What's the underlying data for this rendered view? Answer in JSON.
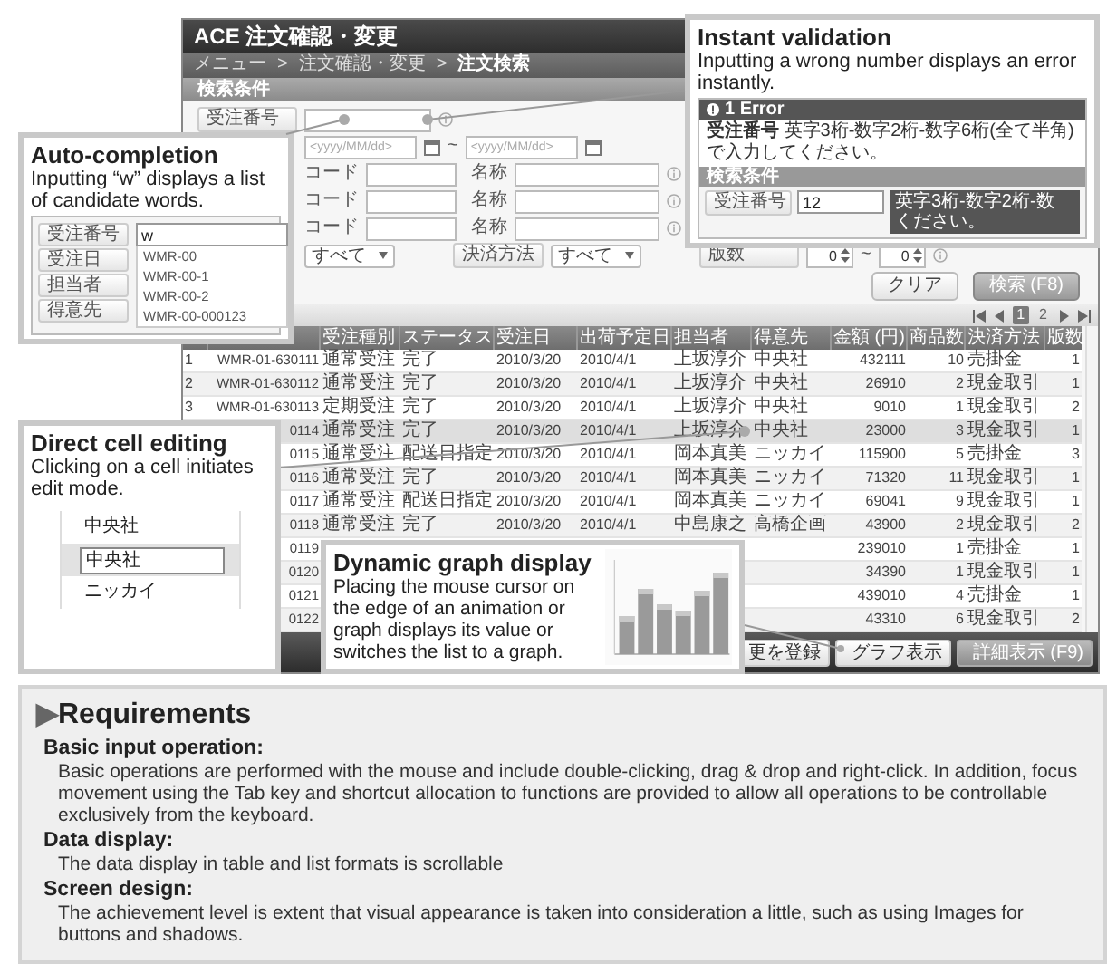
{
  "app": {
    "title": "ACE 注文確認・変更",
    "breadcrumb": [
      {
        "label": "メニュー",
        "kind": "link"
      },
      {
        "label": ">",
        "kind": "separator"
      },
      {
        "label": "注文確認・変更",
        "kind": "link"
      },
      {
        "label": ">",
        "kind": "separator"
      },
      {
        "label": "注文検索",
        "kind": "current"
      }
    ],
    "section_title": "検索条件",
    "search_form": {
      "rows": [
        {
          "kind": "text",
          "label": "受注番号"
        },
        {
          "kind": "date_range",
          "placeholder_from": "<yyyy/MM/dd>",
          "separator": "~",
          "placeholder_to": "<yyyy/MM/dd>"
        },
        {
          "kind": "code_name",
          "code_label": "コード",
          "name_label": "名称"
        },
        {
          "kind": "code_name",
          "code_label": "コード",
          "name_label": "名称"
        },
        {
          "kind": "code_name",
          "code_label": "コード",
          "name_label": "名称"
        },
        {
          "kind": "filters",
          "select_value": "すべて",
          "payment_label": "決済方法",
          "payment_value": "すべて",
          "count_label": "版数",
          "count_from": "0",
          "separator": "~",
          "count_to": "0"
        }
      ],
      "clear_button": "クリア",
      "search_button": "検索 (F8)"
    },
    "pager": {
      "pages": [
        {
          "label": "1",
          "selected": true
        },
        {
          "label": "2",
          "selected": false
        }
      ]
    },
    "table": {
      "columns": [
        "",
        "",
        "受注種別",
        "ステータス",
        "受注日",
        "出荷予定日",
        "担当者",
        "得意先",
        "金額 (円)",
        "商品数",
        "決済方法",
        "版数"
      ],
      "rows": [
        {
          "highlighted": false,
          "cells": [
            "1",
            "WMR-01-630111",
            "通常受注",
            "完了",
            "2010/3/20",
            "2010/4/1",
            "上坂淳介",
            "中央社",
            "432111",
            "10",
            "売掛金",
            "1"
          ]
        },
        {
          "highlighted": false,
          "cells": [
            "2",
            "WMR-01-630112",
            "通常受注",
            "完了",
            "2010/3/20",
            "2010/4/1",
            "上坂淳介",
            "中央社",
            "26910",
            "2",
            "現金取引",
            "1"
          ]
        },
        {
          "highlighted": false,
          "cells": [
            "3",
            "WMR-01-630113",
            "定期受注",
            "完了",
            "2010/3/20",
            "2010/4/1",
            "上坂淳介",
            "中央社",
            "9010",
            "1",
            "現金取引",
            "2"
          ]
        },
        {
          "highlighted": true,
          "cells": [
            null,
            "0114",
            "通常受注",
            "完了",
            "2010/3/20",
            "2010/4/1",
            "上坂淳介",
            "中央社",
            "23000",
            "3",
            "現金取引",
            "1"
          ]
        },
        {
          "highlighted": false,
          "cells": [
            null,
            "0115",
            "通常受注",
            "配送日指定",
            "2010/3/20",
            "2010/4/1",
            "岡本真美",
            "ニッカイ",
            "115900",
            "5",
            "売掛金",
            "3"
          ]
        },
        {
          "highlighted": false,
          "cells": [
            null,
            "0116",
            "通常受注",
            "完了",
            "2010/3/20",
            "2010/4/1",
            "岡本真美",
            "ニッカイ",
            "71320",
            "11",
            "現金取引",
            "1"
          ]
        },
        {
          "highlighted": false,
          "cells": [
            null,
            "0117",
            "通常受注",
            "配送日指定",
            "2010/3/20",
            "2010/4/1",
            "岡本真美",
            "ニッカイ",
            "69041",
            "9",
            "現金取引",
            "1"
          ]
        },
        {
          "highlighted": false,
          "cells": [
            null,
            "0118",
            "通常受注",
            "完了",
            "2010/3/20",
            "2010/4/1",
            "中島康之",
            "高橋企画",
            "43900",
            "2",
            "現金取引",
            "2"
          ]
        },
        {
          "highlighted": false,
          "cells": [
            null,
            "0119",
            null,
            null,
            null,
            null,
            null,
            null,
            "239010",
            "1",
            "売掛金",
            "1"
          ]
        },
        {
          "highlighted": false,
          "cells": [
            null,
            "0120",
            null,
            null,
            null,
            null,
            null,
            null,
            "34390",
            "1",
            "現金取引",
            "1"
          ]
        },
        {
          "highlighted": false,
          "cells": [
            null,
            "0121",
            null,
            null,
            null,
            null,
            null,
            null,
            "439010",
            "4",
            "売掛金",
            "1"
          ]
        },
        {
          "highlighted": false,
          "cells": [
            null,
            "0122",
            null,
            null,
            null,
            null,
            null,
            null,
            "43310",
            "6",
            "現金取引",
            "2"
          ]
        }
      ]
    },
    "footer_buttons": [
      {
        "label": "更を登録",
        "kind": "plain"
      },
      {
        "label": "グラフ表示",
        "kind": "plain"
      },
      {
        "label": "詳細表示 (F9)",
        "kind": "primary"
      }
    ]
  },
  "callouts": [
    {
      "kind": "validation",
      "title": "Instant validation",
      "text": "Inputting a wrong number displays an error instantly.",
      "error_header": "1 Error",
      "error_message": "**受注番号** 英字3桁-数字2桁-数字6桁(全て半角) で入力してください。",
      "section_title": "検索条件",
      "field_label": "受注番号",
      "field_value": "12",
      "tooltip_lines": [
        "英字3桁-数字2桁-数",
        "ください。"
      ]
    },
    {
      "kind": "autocomplete",
      "title": "Auto-completion",
      "text": "Inputting “w” displays a list of candidate words.",
      "labels": [
        "受注番号",
        "受注日",
        "担当者",
        "得意先"
      ],
      "input_value": "w",
      "suggestions": [
        "WMR-00",
        "WMR-00-1",
        "WMR-00-2",
        "WMR-00-000123"
      ]
    },
    {
      "kind": "cell_edit",
      "title": "Direct cell editing",
      "text": "Clicking on a cell initiates edit mode.",
      "cells": [
        {
          "value": "中央社",
          "editing": false
        },
        {
          "value": "中央社",
          "editing": true
        },
        {
          "value": "ニッカイ",
          "editing": false
        }
      ]
    },
    {
      "kind": "graph",
      "title": "Dynamic graph display",
      "text": "Placing the mouse cursor on the edge of an animation or graph displays its value or switches the list to a graph."
    }
  ],
  "requirements": {
    "marker": "▶",
    "heading": "Requirements",
    "sections": [
      {
        "title": "Basic input operation:",
        "text": "Basic operations are performed with the mouse and include double-clicking, drag & drop and right-click. In addition, focus movement using the Tab key and shortcut allocation to functions are provided to allow all operations to be controllable exclusively from the keyboard."
      },
      {
        "title": "Data display:",
        "text": "The data display in table and list formats is scrollable"
      },
      {
        "title": "Screen design:",
        "text": "The achievement level is extent that visual appearance is taken into consideration a little, such as using Images for buttons and shadows."
      }
    ]
  }
}
